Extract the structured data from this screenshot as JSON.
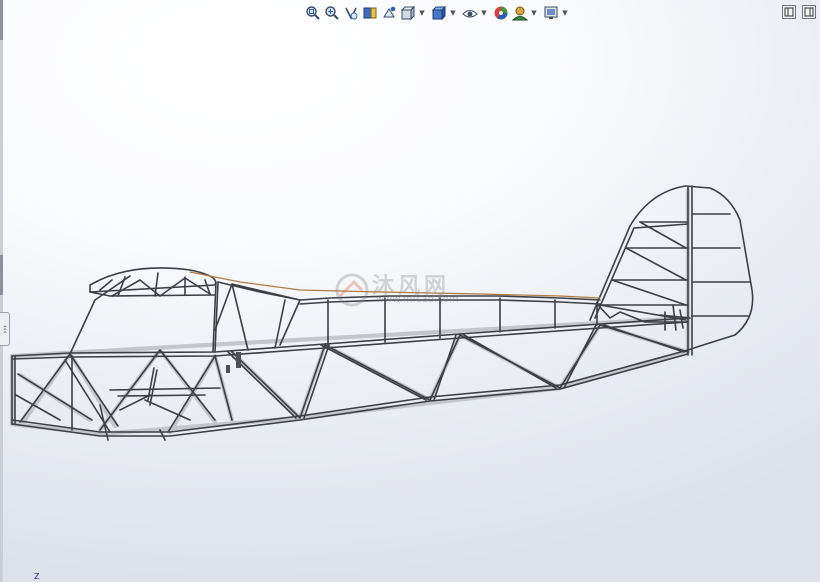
{
  "toolbar": {
    "buttons": [
      {
        "icon": "zoom-to-fit-icon",
        "dropdown": false
      },
      {
        "icon": "zoom-to-area-icon",
        "dropdown": false
      },
      {
        "icon": "previous-view-icon",
        "dropdown": false
      },
      {
        "icon": "section-view-icon",
        "dropdown": false
      },
      {
        "icon": "dynamic-annotation-icon",
        "dropdown": false
      },
      {
        "icon": "view-orientation-icon",
        "dropdown": true
      },
      {
        "icon": "display-style-icon",
        "dropdown": true
      },
      {
        "icon": "hide-show-items-icon",
        "dropdown": true
      },
      {
        "icon": "edit-appearance-icon",
        "dropdown": false
      },
      {
        "icon": "apply-scene-icon",
        "dropdown": true
      },
      {
        "icon": "view-settings-icon",
        "dropdown": true
      }
    ]
  },
  "window_controls": [
    "split-view-left-icon",
    "split-view-right-icon"
  ],
  "triad": {
    "axis_label": "Z"
  },
  "watermark": {
    "text": "沐风网",
    "url": "www.mfcad.com"
  },
  "colors": {
    "frame": "#3c3f46",
    "frame_light": "#b9bcc3",
    "stringer": "#b07a45",
    "accent_blue": "#2b5db8"
  }
}
